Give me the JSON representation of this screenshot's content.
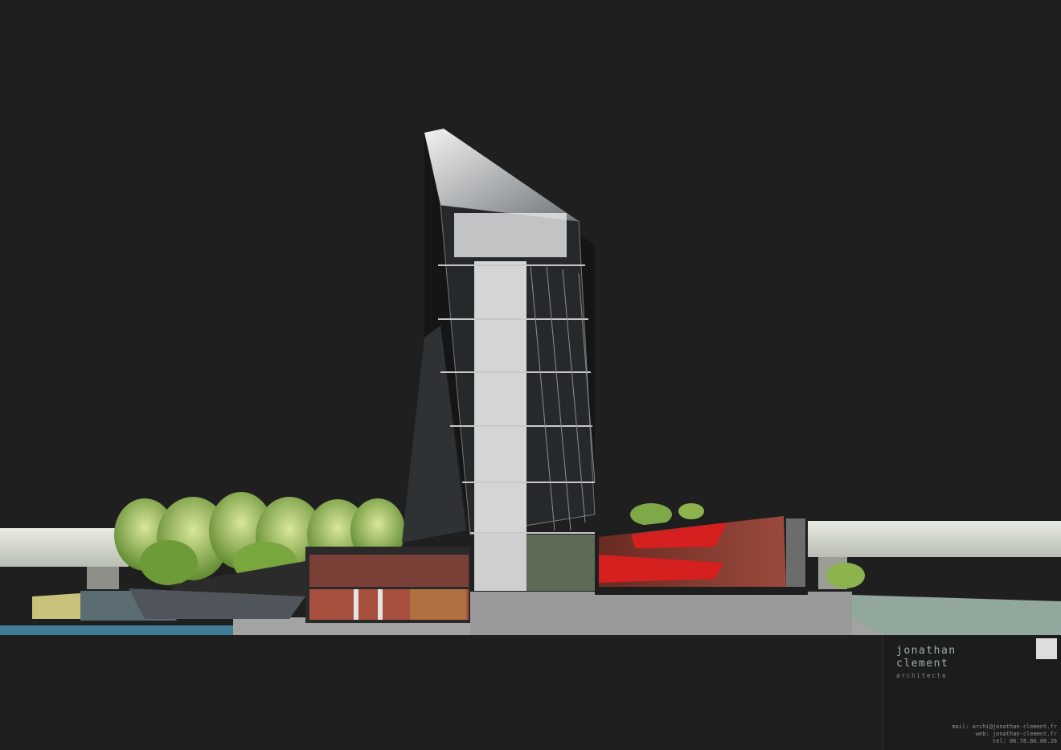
{
  "title_block": {
    "name_line1": "jonathan",
    "name_line2": "clement",
    "role": "architecte",
    "mail": "mail: archi@jonathan-clement.fr",
    "web": "web: jonathan-clement.fr",
    "tel": "tel: 06.78.86.86.26"
  },
  "icons": {
    "qr": "qr-code-icon"
  },
  "colors": {
    "background": "#1f1f1f",
    "tower_glass": "#3a3d40",
    "seats": "#d62020",
    "ground": "#9a9a9a",
    "water": "#3f6f80",
    "trees": "#9dbf5a"
  }
}
